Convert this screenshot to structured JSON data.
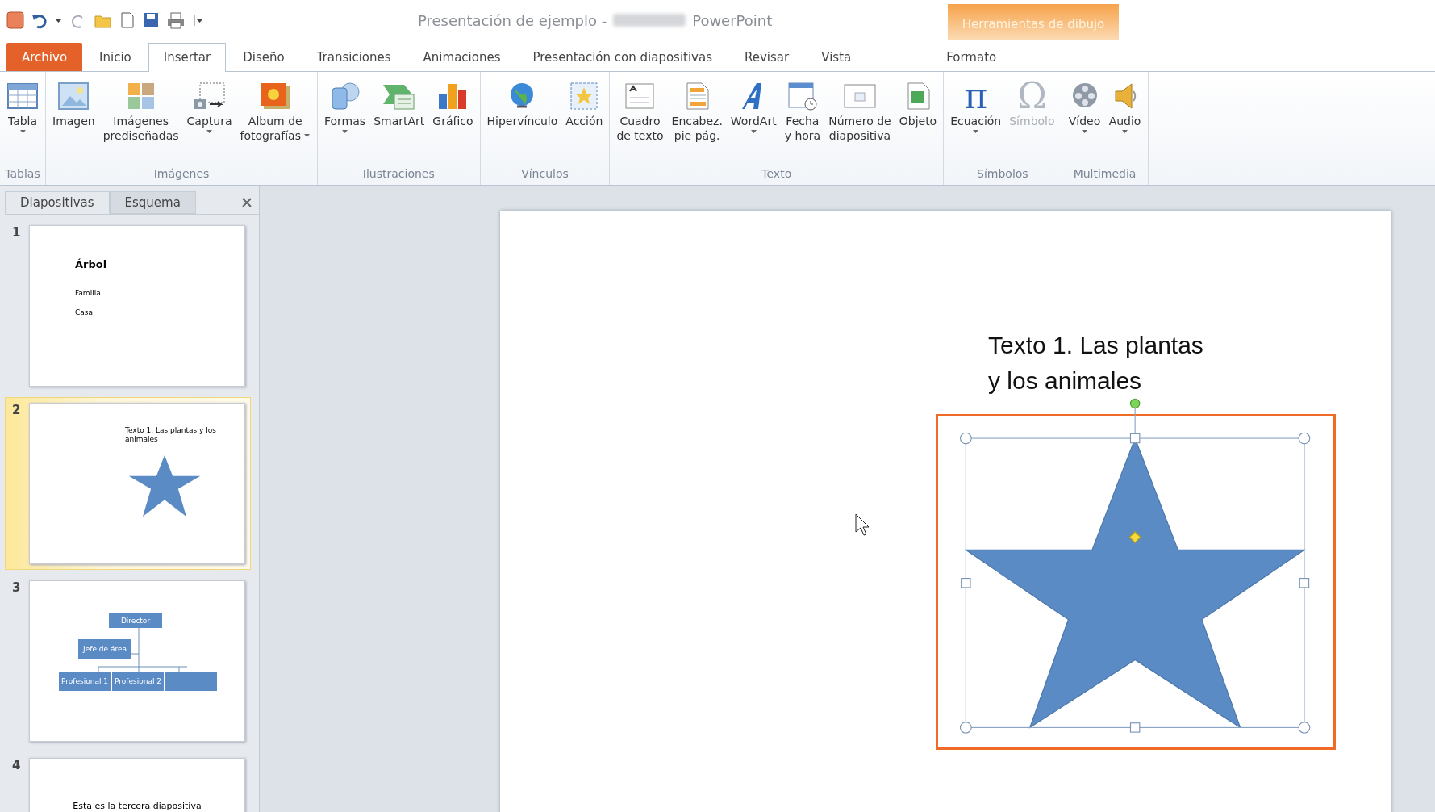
{
  "title_bar": {
    "document": "Presentación de ejemplo -",
    "app": "PowerPoint",
    "context_group": "Herramientas de dibujo"
  },
  "tabs": [
    {
      "label": "Archivo",
      "kind": "file",
      "selected": false
    },
    {
      "label": "Inicio",
      "kind": "tab",
      "selected": false
    },
    {
      "label": "Insertar",
      "kind": "tab",
      "selected": true
    },
    {
      "label": "Diseño",
      "kind": "tab",
      "selected": false
    },
    {
      "label": "Transiciones",
      "kind": "tab",
      "selected": false
    },
    {
      "label": "Animaciones",
      "kind": "tab",
      "selected": false
    },
    {
      "label": "Presentación con diapositivas",
      "kind": "tab",
      "selected": false
    },
    {
      "label": "Revisar",
      "kind": "tab",
      "selected": false
    },
    {
      "label": "Vista",
      "kind": "tab",
      "selected": false
    },
    {
      "label": "Formato",
      "kind": "context",
      "selected": false
    }
  ],
  "ribbon_groups": [
    {
      "label": "Tablas",
      "commands": [
        {
          "lines": [
            "Tabla"
          ],
          "dropdown": true,
          "disabled": false
        }
      ]
    },
    {
      "label": "Imágenes",
      "commands": [
        {
          "lines": [
            "Imagen"
          ],
          "dropdown": false,
          "disabled": false
        },
        {
          "lines": [
            "Imágenes",
            "prediseñadas"
          ],
          "dropdown": false,
          "disabled": false
        },
        {
          "lines": [
            "Captura"
          ],
          "dropdown": true,
          "disabled": false
        },
        {
          "lines": [
            "Álbum de",
            "fotografías"
          ],
          "dropdown": true,
          "inline_dropdown": true,
          "disabled": false
        }
      ]
    },
    {
      "label": "Ilustraciones",
      "commands": [
        {
          "lines": [
            "Formas"
          ],
          "dropdown": true,
          "disabled": false
        },
        {
          "lines": [
            "SmartArt"
          ],
          "dropdown": false,
          "disabled": false
        },
        {
          "lines": [
            "Gráfico"
          ],
          "dropdown": false,
          "disabled": false
        }
      ]
    },
    {
      "label": "Vínculos",
      "commands": [
        {
          "lines": [
            "Hipervínculo"
          ],
          "dropdown": false,
          "disabled": false
        },
        {
          "lines": [
            "Acción"
          ],
          "dropdown": false,
          "disabled": false
        }
      ]
    },
    {
      "label": "Texto",
      "commands": [
        {
          "lines": [
            "Cuadro",
            "de texto"
          ],
          "dropdown": false,
          "disabled": false
        },
        {
          "lines": [
            "Encabez.",
            "pie pág."
          ],
          "dropdown": false,
          "disabled": false
        },
        {
          "lines": [
            "WordArt"
          ],
          "dropdown": true,
          "disabled": false
        },
        {
          "lines": [
            "Fecha",
            "y hora"
          ],
          "dropdown": false,
          "disabled": false
        },
        {
          "lines": [
            "Número de",
            "diapositiva"
          ],
          "dropdown": false,
          "disabled": false
        },
        {
          "lines": [
            "Objeto"
          ],
          "dropdown": false,
          "disabled": false
        }
      ]
    },
    {
      "label": "Símbolos",
      "commands": [
        {
          "lines": [
            "Ecuación"
          ],
          "dropdown": true,
          "disabled": false,
          "glyph": "π"
        },
        {
          "lines": [
            "Símbolo"
          ],
          "dropdown": false,
          "disabled": true,
          "glyph": "Ω"
        }
      ]
    },
    {
      "label": "Multimedia",
      "commands": [
        {
          "lines": [
            "Vídeo"
          ],
          "dropdown": true,
          "disabled": false
        },
        {
          "lines": [
            "Audio"
          ],
          "dropdown": true,
          "disabled": false
        }
      ]
    }
  ],
  "slides_pane": {
    "tabs": [
      {
        "label": "Diapositivas",
        "selected": true
      },
      {
        "label": "Esquema",
        "selected": false
      }
    ]
  },
  "slides": [
    {
      "number": "1",
      "kind": "title",
      "selected": false,
      "title": "Árbol",
      "lines": [
        "Familia",
        "Casa"
      ]
    },
    {
      "number": "2",
      "kind": "star",
      "selected": true,
      "text": "Texto 1. Las plantas y los animales"
    },
    {
      "number": "3",
      "kind": "org",
      "selected": false,
      "boxes": [
        "Director",
        "Jefe de área",
        "Profesional 1",
        "Profesional 2"
      ]
    },
    {
      "number": "4",
      "kind": "text",
      "selected": false,
      "text": "Esta es la tercera diapositiva"
    }
  ],
  "canvas": {
    "text_lines": [
      "Texto 1. Las plantas",
      "y los animales"
    ],
    "selected": true
  }
}
